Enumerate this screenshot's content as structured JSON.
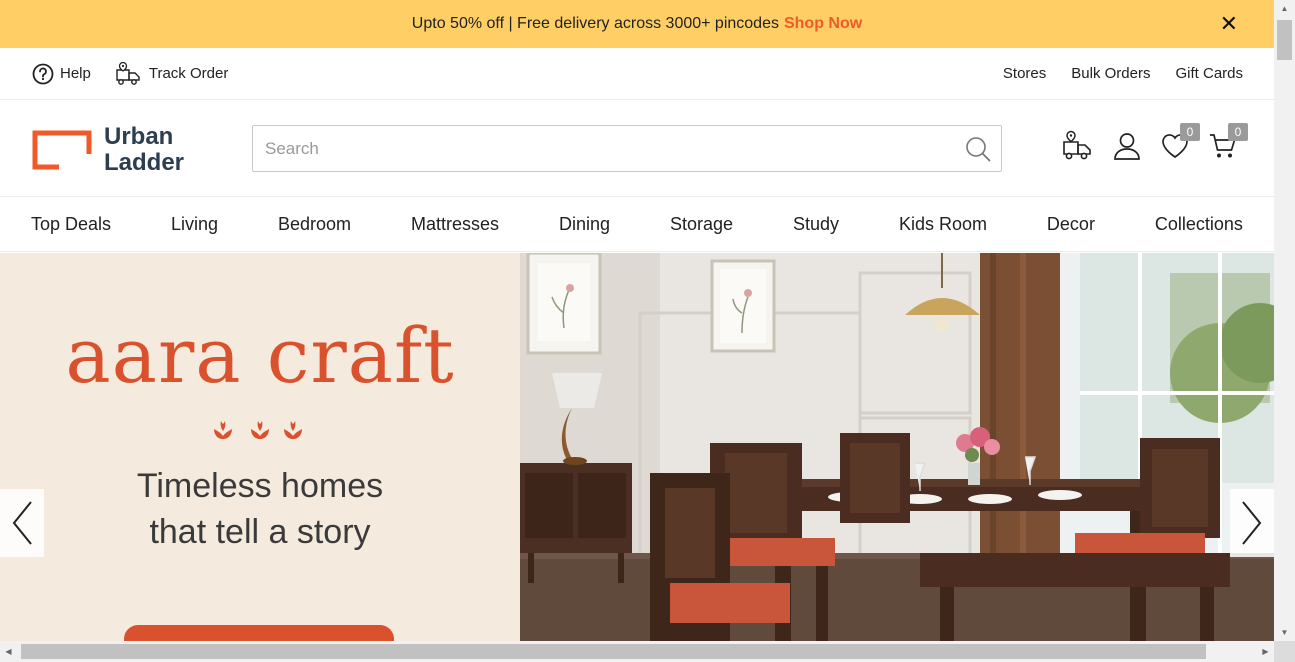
{
  "promo": {
    "text": "Upto 50% off | Free delivery across 3000+ pincodes",
    "link": "Shop Now",
    "close": "✕"
  },
  "utility": {
    "help": "Help",
    "track_order": "Track Order",
    "links": [
      "Stores",
      "Bulk Orders",
      "Gift Cards"
    ]
  },
  "brand": {
    "line1": "Urban",
    "line2": "Ladder",
    "accent": "#f05a28",
    "text_color": "#2c3e50"
  },
  "search": {
    "placeholder": "Search"
  },
  "header_icons": {
    "wishlist_count": "0",
    "cart_count": "0"
  },
  "nav": {
    "items": [
      "Top Deals",
      "Living",
      "Bedroom",
      "Mattresses",
      "Dining",
      "Storage",
      "Study",
      "Kids Room",
      "Decor",
      "Collections"
    ]
  },
  "hero": {
    "title": "aara craft",
    "subtitle_line1": "Timeless homes",
    "subtitle_line2": "that tell a story",
    "accent": "#d9522d",
    "background": "#f4ebde"
  },
  "icons": {
    "help": "help-circle-icon",
    "track": "delivery-truck-icon",
    "search": "magnifier-icon",
    "account": "user-icon",
    "wishlist": "heart-icon",
    "cart": "cart-icon",
    "prev": "chevron-left-icon",
    "next": "chevron-right-icon"
  }
}
